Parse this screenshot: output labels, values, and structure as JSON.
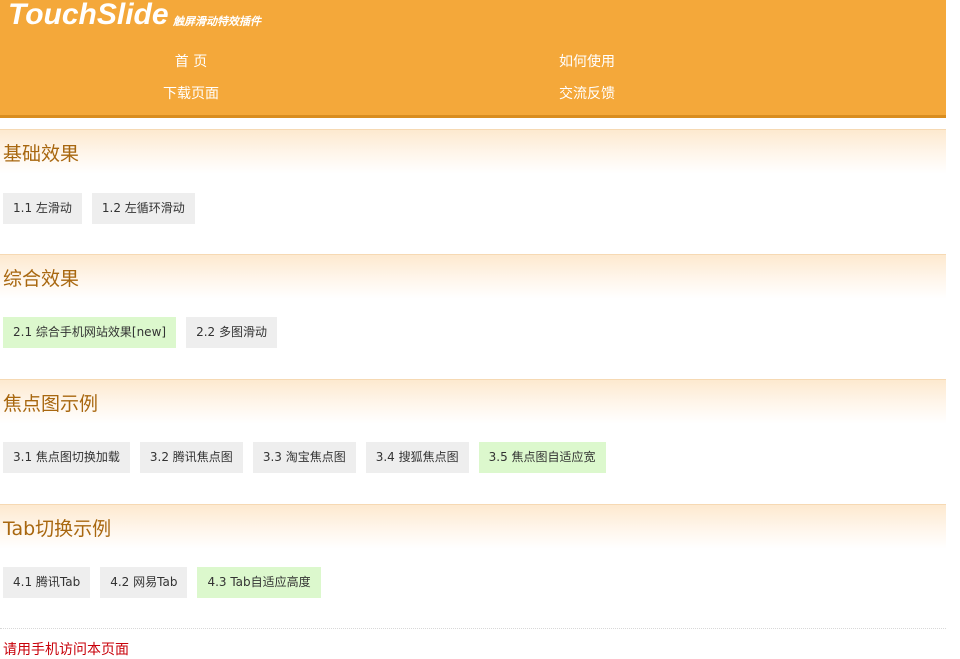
{
  "header": {
    "logo": "TouchSlide",
    "subtitle": "触屏滑动特效插件",
    "nav": [
      "首  页",
      "如何使用",
      "下载页面",
      "交流反馈"
    ]
  },
  "sections": [
    {
      "title": "基础效果",
      "buttons": [
        {
          "label": "1.1 左滑动",
          "highlight": false
        },
        {
          "label": "1.2 左循环滑动",
          "highlight": false
        }
      ]
    },
    {
      "title": "综合效果",
      "buttons": [
        {
          "label": "2.1 综合手机网站效果[new]",
          "highlight": true
        },
        {
          "label": "2.2 多图滑动",
          "highlight": false
        }
      ]
    },
    {
      "title": "焦点图示例",
      "buttons": [
        {
          "label": "3.1 焦点图切换加载",
          "highlight": false
        },
        {
          "label": "3.2 腾讯焦点图",
          "highlight": false
        },
        {
          "label": "3.3 淘宝焦点图",
          "highlight": false
        },
        {
          "label": "3.4 搜狐焦点图",
          "highlight": false
        },
        {
          "label": "3.5 焦点图自适应宽",
          "highlight": true
        }
      ]
    },
    {
      "title": "Tab切换示例",
      "buttons": [
        {
          "label": "4.1 腾讯Tab",
          "highlight": false
        },
        {
          "label": "4.2 网易Tab",
          "highlight": false
        },
        {
          "label": "4.3 Tab自适应高度",
          "highlight": true
        }
      ]
    }
  ],
  "footer": {
    "text": "请用手机访问本页面"
  },
  "colors": {
    "header_bg": "#f4a83a",
    "section_title": "#a8670f",
    "button_bg": "#eeeeee",
    "button_new_bg": "#dcf8cd",
    "footer_text": "#c8000a"
  }
}
